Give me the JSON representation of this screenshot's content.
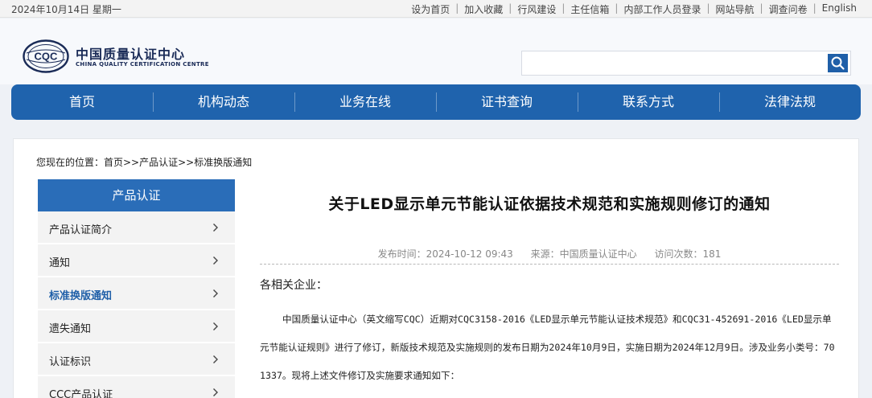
{
  "topbar": {
    "date": "2024年10月14日  星期一",
    "links": [
      "设为首页",
      "加入收藏",
      "行风建设",
      "主任信箱",
      "内部工作人员登录",
      "网站导航",
      "调查问卷",
      "English"
    ]
  },
  "logo": {
    "emblem_text": "CQC",
    "name_cn": "中国质量认证中心",
    "name_en": "CHINA QUALITY CERTIFICATION CENTRE"
  },
  "search": {
    "value": "",
    "placeholder": ""
  },
  "nav": [
    "首页",
    "机构动态",
    "业务在线",
    "证书查询",
    "联系方式",
    "法律法规"
  ],
  "breadcrumb": "您现在的位置：首页>>产品认证>>标准换版通知",
  "sidebar": {
    "title": "产品认证",
    "items": [
      "产品认证简介",
      "通知",
      "标准换版通知",
      "遗失通知",
      "认证标识",
      "CCC产品认证"
    ],
    "active_index": 2
  },
  "article": {
    "title": "关于LED显示单元节能认证依据技术规范和实施规则修订的通知",
    "meta": {
      "publish_time": "发布时间：2024-10-12 09:43",
      "source": "来源：中国质量认证中心",
      "visits": "访问次数：181"
    },
    "greeting": "各相关企业：",
    "paragraph": "中国质量认证中心（英文缩写CQC）近期对CQC3158-2016《LED显示单元节能认证技术规范》和CQC31-452691-2016《LED显示单元节能认证规则》进行了修订，新版技术规范及实施规则的发布日期为2024年10月9日，实施日期为2024年12月9日。涉及业务小类号：701337。现将上述文件修订及实施要求通知如下："
  },
  "colors": {
    "nav_bg": "#1f63ad",
    "sidebar_title_bg": "#2a6db8",
    "active_link": "#1f5fa8"
  }
}
